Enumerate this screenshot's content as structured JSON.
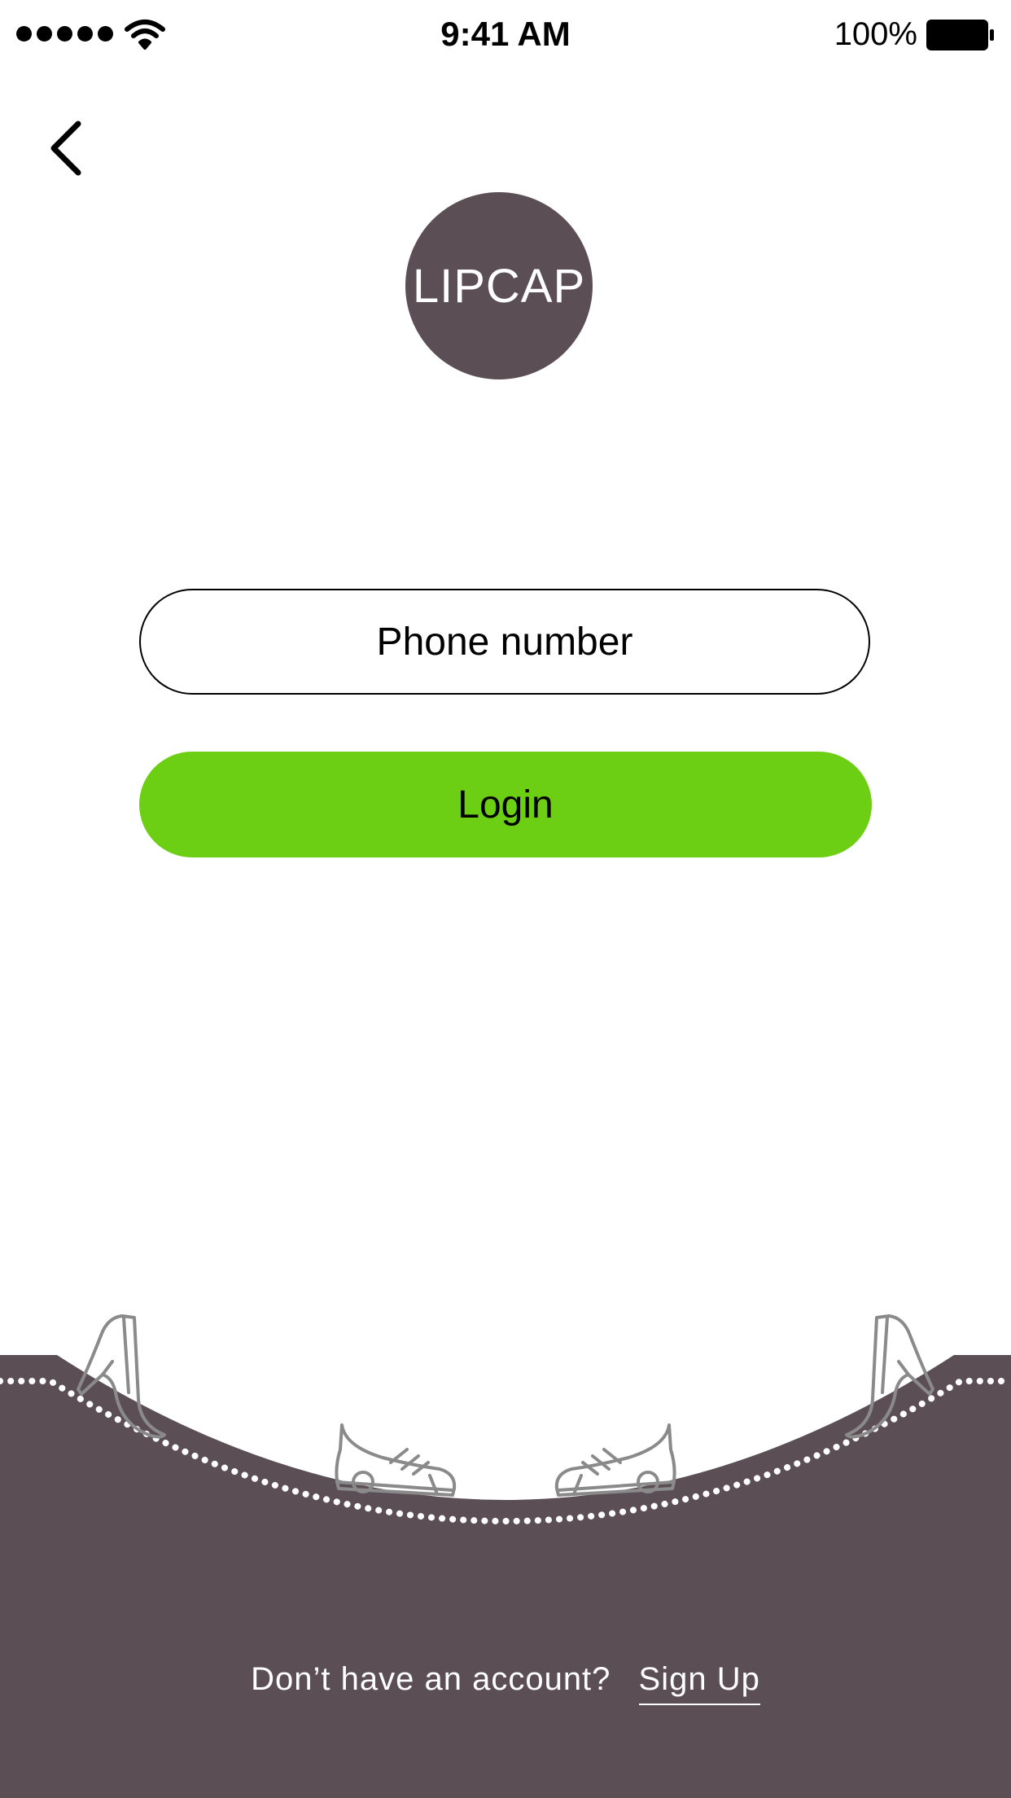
{
  "status_bar": {
    "time": "9:41 AM",
    "battery_percent": "100%",
    "icons": [
      "signal-dots-icon",
      "wifi-icon",
      "battery-icon"
    ]
  },
  "header": {
    "back_icon": "chevron-left-icon"
  },
  "logo": {
    "text": "LIPCAP"
  },
  "form": {
    "phone_placeholder": "Phone number",
    "login_label": "Login"
  },
  "footer": {
    "prompt": "Don’t have an account?",
    "signup_label": "Sign Up",
    "icons": [
      "high-heel-shoe-icon",
      "sneaker-icon"
    ]
  },
  "colors": {
    "brand": "#5b4f55",
    "accent": "#6ccf14",
    "background": "#ffffff"
  }
}
